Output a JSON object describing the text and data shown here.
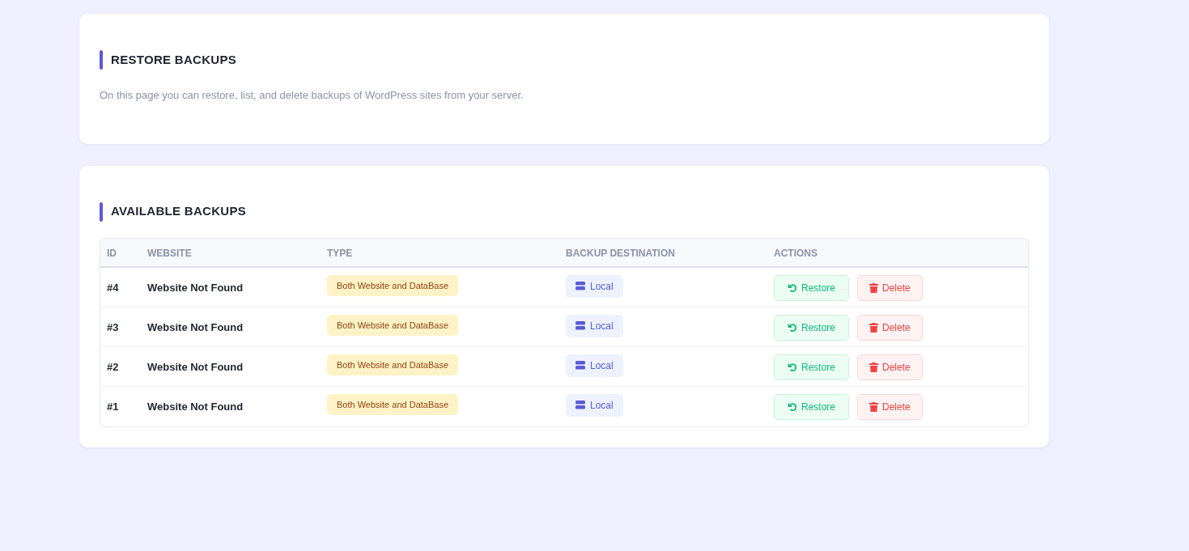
{
  "intro": {
    "title": "RESTORE BACKUPS",
    "description": "On this page you can restore, list, and delete backups of WordPress sites from your server."
  },
  "backups": {
    "title": "AVAILABLE BACKUPS",
    "columns": [
      "ID",
      "WEBSITE",
      "TYPE",
      "BACKUP DESTINATION",
      "ACTIONS"
    ],
    "rows": [
      {
        "id": "#4",
        "website": "Website Not Found",
        "type": "Both Website and DataBase",
        "destination": "Local",
        "restore": "Restore",
        "delete": "Delete"
      },
      {
        "id": "#3",
        "website": "Website Not Found",
        "type": "Both Website and DataBase",
        "destination": "Local",
        "restore": "Restore",
        "delete": "Delete"
      },
      {
        "id": "#2",
        "website": "Website Not Found",
        "type": "Both Website and DataBase",
        "destination": "Local",
        "restore": "Restore",
        "delete": "Delete"
      },
      {
        "id": "#1",
        "website": "Website Not Found",
        "type": "Both Website and DataBase",
        "destination": "Local",
        "restore": "Restore",
        "delete": "Delete"
      }
    ]
  }
}
